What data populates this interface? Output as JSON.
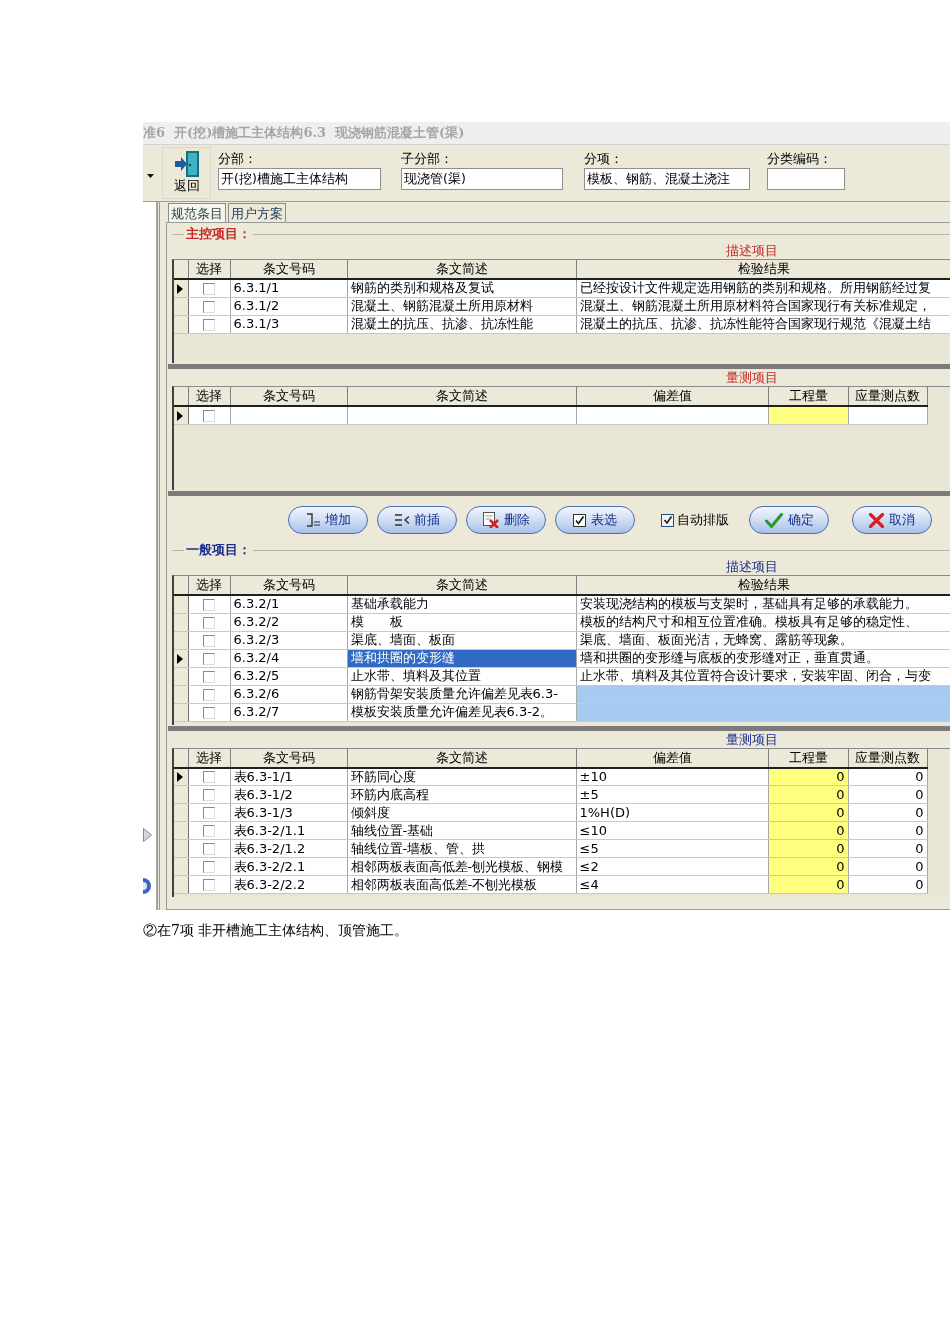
{
  "title_bar": {
    "title": "准6  开(挖)槽施工主体结构6.3  现浇钢筋混凝土管(渠)"
  },
  "toolbar": {
    "back_label": "返回",
    "fields": [
      {
        "label": "分部：",
        "value": "开(挖)槽施工主体结构"
      },
      {
        "label": "子分部：",
        "value": "现浇管(渠)"
      },
      {
        "label": "分项：",
        "value": "模板、钢筋、混凝土浇注"
      },
      {
        "label": "分类编码："
      }
    ]
  },
  "tabs": [
    {
      "label": "规范条目",
      "selected": true
    },
    {
      "label": "用户方案",
      "selected": false
    }
  ],
  "panels": [
    {
      "kind": "section",
      "title": "主控项目：",
      "color": "#c62a2a",
      "description": {
        "caption": "描述项目",
        "columns": [
          "选择",
          "条文号码",
          "条文简述",
          "检验结果"
        ],
        "rows": [
          {
            "selected": true,
            "checked": false,
            "summary_highlighted": false,
            "result_shaded": false,
            "code": "6.3.1/1",
            "summary": "钢筋的类别和规格及复试",
            "result": "已经按设计文件规定选用钢筋的类别和规格。所用钢筋经过复"
          },
          {
            "selected": false,
            "checked": false,
            "summary_highlighted": false,
            "result_shaded": false,
            "code": "6.3.1/2",
            "summary": "混凝土、钢筋混凝土所用原材料",
            "result": "混凝土、钢筋混凝土所用原材料符合国家现行有关标准规定，"
          },
          {
            "selected": false,
            "checked": false,
            "summary_highlighted": false,
            "result_shaded": false,
            "code": "6.3.1/3",
            "summary": "混凝土的抗压、抗渗、抗冻性能",
            "result": "混凝土的抗压、抗渗、抗冻性能符合国家现行规范《混凝土结"
          }
        ]
      },
      "measurement": {
        "caption": "量测项目",
        "columns": [
          "选择",
          "条文号码",
          "条文简述",
          "偏差值",
          "工程量",
          "应量测点数"
        ],
        "rows": [
          {
            "selected": true,
            "checked": false
          }
        ]
      }
    },
    {
      "kind": "actions",
      "items": [
        {
          "kind": "add",
          "label": "增加"
        },
        {
          "kind": "insert",
          "label": "前插"
        },
        {
          "kind": "delete",
          "label": "删除"
        },
        {
          "kind": "pick",
          "label": "表选"
        },
        {
          "kind": "checkbox",
          "label": "自动排版",
          "checked": true
        },
        {
          "kind": "confirm",
          "label": "确定"
        },
        {
          "kind": "cancel",
          "label": "取消"
        }
      ]
    },
    {
      "kind": "section",
      "title": "一般项目：",
      "color": "#1c2f90",
      "description": {
        "caption": "描述项目",
        "columns": [
          "选择",
          "条文号码",
          "条文简述",
          "检验结果"
        ],
        "rows": [
          {
            "selected": false,
            "checked": false,
            "summary_highlighted": false,
            "result_shaded": false,
            "code": "6.3.2/1",
            "summary": "基础承载能力",
            "result": "安装现浇结构的模板与支架时，基础具有足够的承载能力。"
          },
          {
            "selected": false,
            "checked": false,
            "summary_highlighted": false,
            "result_shaded": false,
            "code": "6.3.2/2",
            "summary": "模　　板",
            "result": "模板的结构尺寸和相互位置准确。模板具有足够的稳定性、"
          },
          {
            "selected": false,
            "checked": false,
            "summary_highlighted": false,
            "result_shaded": false,
            "code": "6.3.2/3",
            "summary": "渠底、墙面、板面",
            "result": "渠底、墙面、板面光洁，无蜂窝、露筋等现象。"
          },
          {
            "selected": true,
            "checked": false,
            "summary_highlighted": true,
            "result_shaded": false,
            "code": "6.3.2/4",
            "summary": "墙和拱圈的变形缝",
            "result": "墙和拱圈的变形缝与底板的变形缝对正，垂直贯通。"
          },
          {
            "selected": false,
            "checked": false,
            "summary_highlighted": false,
            "result_shaded": false,
            "code": "6.3.2/5",
            "summary": "止水带、填料及其位置",
            "result": "止水带、填料及其位置符合设计要求，安装牢固、闭合，与变"
          },
          {
            "selected": false,
            "checked": false,
            "summary_highlighted": false,
            "result_shaded": true,
            "code": "6.3.2/6",
            "summary": "钢筋骨架安装质量允许偏差见表6.3-"
          },
          {
            "selected": false,
            "checked": false,
            "summary_highlighted": false,
            "result_shaded": true,
            "code": "6.3.2/7",
            "summary": "模板安装质量允许偏差见表6.3-2。"
          }
        ]
      },
      "measurement": {
        "caption": "量测项目",
        "columns": [
          "选择",
          "条文号码",
          "条文简述",
          "偏差值",
          "工程量",
          "应量测点数"
        ],
        "rows": [
          {
            "selected": true,
            "checked": false,
            "code": "表6.3-1/1",
            "summary": "环筋同心度",
            "deviation": "±10",
            "quantity": "0",
            "points": "0"
          },
          {
            "selected": false,
            "checked": false,
            "code": "表6.3-1/2",
            "summary": "环筋内底高程",
            "deviation": "±5",
            "quantity": "0",
            "points": "0"
          },
          {
            "selected": false,
            "checked": false,
            "code": "表6.3-1/3",
            "summary": "倾斜度",
            "deviation": "1%H(D)",
            "quantity": "0",
            "points": "0"
          },
          {
            "selected": false,
            "checked": false,
            "code": "表6.3-2/1.1",
            "summary": "轴线位置-基础",
            "deviation": "≤10",
            "quantity": "0",
            "points": "0"
          },
          {
            "selected": false,
            "checked": false,
            "code": "表6.3-2/1.2",
            "summary": "轴线位置-墙板、管、拱",
            "deviation": "≤5",
            "quantity": "0",
            "points": "0"
          },
          {
            "selected": false,
            "checked": false,
            "code": "表6.3-2/2.1",
            "summary": "相邻两板表面高低差-刨光模板、钢模",
            "deviation": "≤2",
            "quantity": "0",
            "points": "0"
          },
          {
            "selected": false,
            "checked": false,
            "code": "表6.3-2/2.2",
            "summary": "相邻两板表面高低差-不刨光模板",
            "deviation": "≤4",
            "quantity": "0",
            "points": "0"
          }
        ]
      }
    }
  ],
  "note": "②在7项 非开槽施工主体结构、顶管施工。"
}
